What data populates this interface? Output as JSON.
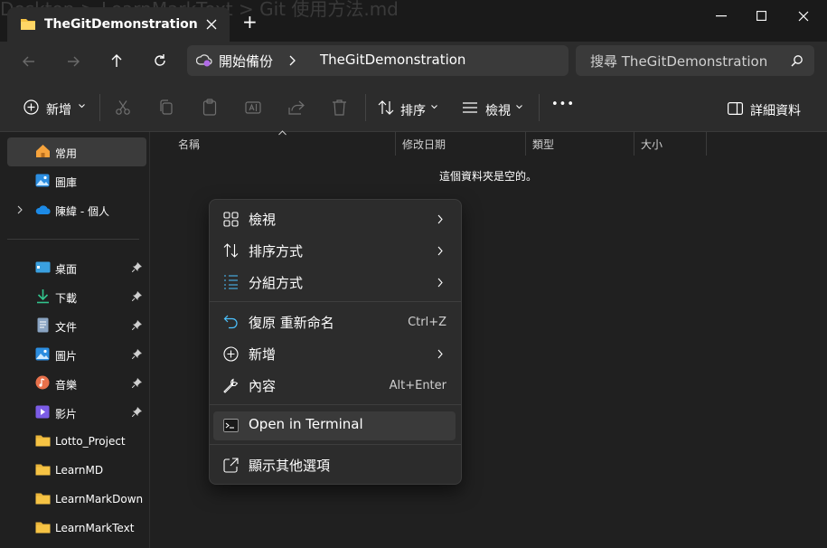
{
  "window": {
    "background_path_text": "Desktop > LearnMarkText > Git 使用方法.md",
    "tab_title": "TheGitDemonstration",
    "new_tab_label": "+"
  },
  "address": {
    "segments": [
      "開始備份",
      "TheGitDemonstration"
    ],
    "search_placeholder": "搜尋 TheGitDemonstration"
  },
  "toolbar": {
    "new_label": "新增",
    "sort_label": "排序",
    "view_label": "檢視",
    "more_label": "•••",
    "details_label": "詳細資料"
  },
  "sidebar": {
    "items": [
      {
        "label": "常用",
        "icon": "home-icon"
      },
      {
        "label": "圖庫",
        "icon": "gallery-icon"
      },
      {
        "label": "陳緯 - 個人",
        "icon": "onedrive-icon"
      },
      {
        "label": "桌面",
        "icon": "desktop-icon"
      },
      {
        "label": "下載",
        "icon": "download-icon"
      },
      {
        "label": "文件",
        "icon": "documents-icon"
      },
      {
        "label": "圖片",
        "icon": "pictures-icon"
      },
      {
        "label": "音樂",
        "icon": "music-icon"
      },
      {
        "label": "影片",
        "icon": "videos-icon"
      },
      {
        "label": "Lotto_Project",
        "icon": "folder-icon"
      },
      {
        "label": "LearnMD",
        "icon": "folder-icon"
      },
      {
        "label": "LearnMarkDown",
        "icon": "folder-icon"
      },
      {
        "label": "LearnMarkText",
        "icon": "folder-icon"
      }
    ]
  },
  "columns": [
    "名稱",
    "修改日期",
    "類型",
    "大小"
  ],
  "empty_message": "這個資料夾是空的。",
  "context_menu": {
    "items": [
      {
        "label": "檢視",
        "shortcut": "",
        "icon": "grid-icon"
      },
      {
        "label": "排序方式",
        "shortcut": "",
        "icon": "sort-icon"
      },
      {
        "label": "分組方式",
        "shortcut": "",
        "icon": "group-icon"
      },
      {
        "label": "復原 重新命名",
        "shortcut": "Ctrl+Z",
        "icon": "undo-icon"
      },
      {
        "label": "新增",
        "shortcut": "",
        "icon": "add-icon"
      },
      {
        "label": "內容",
        "shortcut": "Alt+Enter",
        "icon": "wrench-icon"
      },
      {
        "label": "Open in Terminal",
        "shortcut": "",
        "icon": "terminal-icon"
      },
      {
        "label": "顯示其他選項",
        "shortcut": "",
        "icon": "more-options-icon"
      }
    ]
  },
  "colors": {
    "accent": "#4cc2ff",
    "folder": "#f6c344",
    "background": "#202020"
  }
}
